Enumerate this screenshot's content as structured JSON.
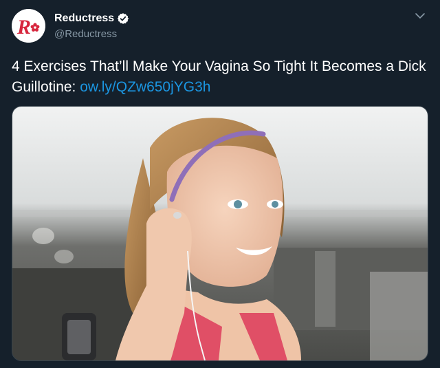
{
  "account": {
    "display_name": "Reductress",
    "handle": "@Reductress",
    "verified": true,
    "avatar_icon": "reductress-logo-icon",
    "avatar_logo_text": "R"
  },
  "menu": {
    "icon": "chevron-down-icon"
  },
  "tweet": {
    "text": "4 Exercises That’ll Make Your Vagina So Tight It Becomes a Dick Guillotine: ",
    "link_text": "ow.ly/QZw650jYG3h"
  },
  "colors": {
    "background": "#15202b",
    "text": "#ffffff",
    "secondary_text": "#8899a6",
    "link": "#1b95e0",
    "verified_badge": "#ffffff",
    "brand_red": "#d7263d"
  },
  "media": {
    "type": "photo",
    "icon": "photo-image"
  }
}
